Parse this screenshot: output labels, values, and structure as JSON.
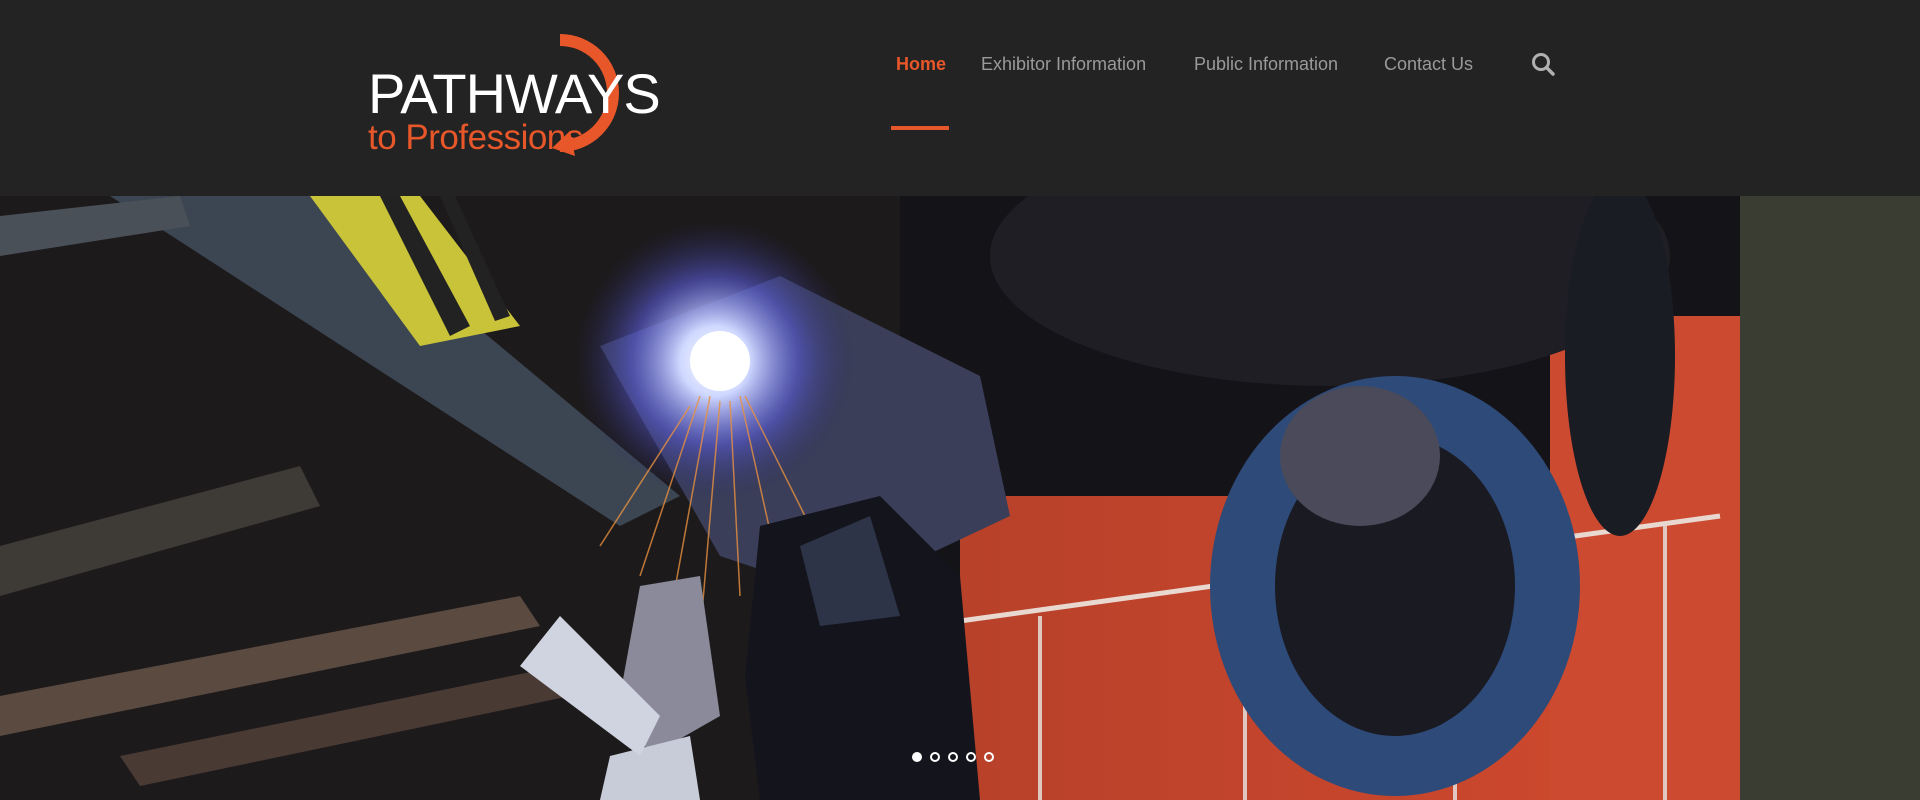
{
  "site": {
    "logo": {
      "line1": "PATHWAYS",
      "line2": "to Professions",
      "accent": "#e8572a"
    }
  },
  "nav": {
    "items": [
      {
        "label": "Home",
        "active": true
      },
      {
        "label": "Exhibitor Information",
        "active": false
      },
      {
        "label": "Public Information",
        "active": false
      },
      {
        "label": "Contact Us",
        "active": false
      }
    ],
    "search_icon": "search-icon"
  },
  "hero": {
    "slide_count": 5,
    "active_slide": 1
  },
  "colors": {
    "header_bg": "#232323",
    "accent": "#e8572a",
    "nav_text": "#9a9a9a"
  }
}
